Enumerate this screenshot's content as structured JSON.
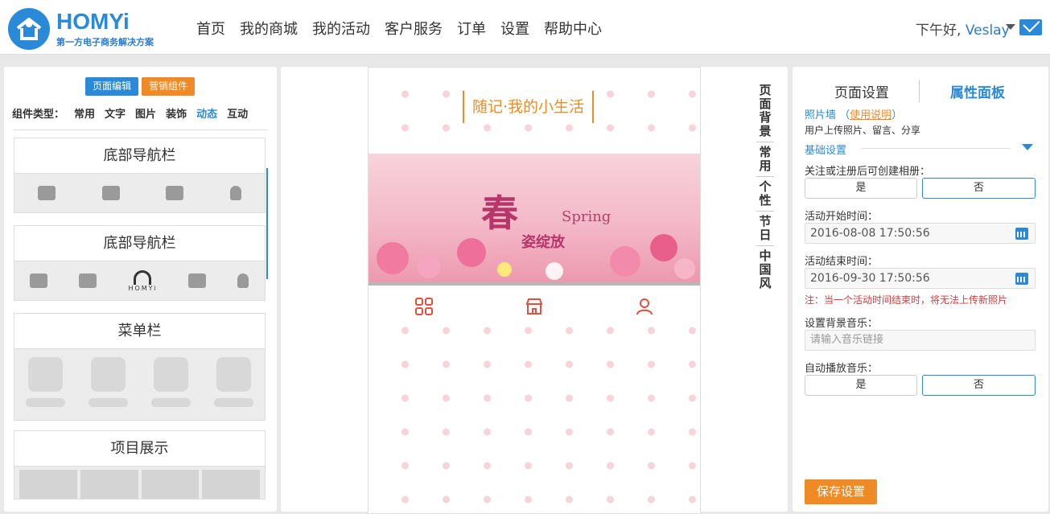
{
  "header": {
    "brand": "HOMYi",
    "brand_sub": "第一方电子商务解决方案",
    "nav": [
      "首页",
      "我的商城",
      "我的活动",
      "客户服务",
      "订单",
      "设置",
      "帮助中心"
    ],
    "greeting": "下午好, ",
    "username": "Veslay"
  },
  "left": {
    "btn_edit": "页面编辑",
    "btn_market": "营销组件",
    "types_label": "组件类型：",
    "types": [
      "常用",
      "文字",
      "图片",
      "装饰",
      "动态",
      "互动"
    ],
    "active_type": "动态",
    "components": [
      "底部导航栏",
      "底部导航栏",
      "菜单栏",
      "项目展示"
    ],
    "homy_mini_text": "HOMYi"
  },
  "preview": {
    "title": "随记·我的小生活",
    "banner_big": "春",
    "banner_spring": "Spring",
    "banner_sub": "姿绽放"
  },
  "bg_menu": {
    "title": "页面背景",
    "items": [
      "常用",
      "个性",
      "节日",
      "中国风"
    ]
  },
  "right": {
    "tab_page": "页面设置",
    "tab_attr": "属性面板",
    "widget_name": "照片墙",
    "help_prefix": "（",
    "help_link": "使用说明",
    "help_suffix": "）",
    "widget_desc": "用户上传照片、留言、分享",
    "section_basic": "基础设置",
    "q_create_album": "关注或注册后可创建相册：",
    "yes": "是",
    "no": "否",
    "start_label": "活动开始时间：",
    "start_value": "2016-08-08 17:50:56",
    "end_label": "活动结束时间：",
    "end_value": "2016-09-30 17:50:56",
    "note": "注：当一个活动时间结束时，将无法上传新照片",
    "music_label": "设置背景音乐：",
    "music_placeholder": "请输入音乐链接",
    "autoplay_label": "自动播放音乐：",
    "save": "保存设置"
  },
  "colors": {
    "primary": "#2a8ad8",
    "accent": "#f08a24",
    "warning": "#d53b3b"
  }
}
